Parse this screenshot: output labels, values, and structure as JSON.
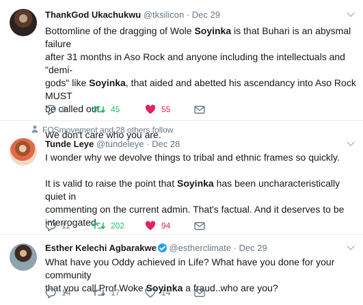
{
  "tweets": [
    {
      "name": "ThankGod Ukachukwu",
      "handle": "@tksilicon",
      "dot": "·",
      "date": "Dec 29",
      "line1a": "Bottomline of the dragging of Wole ",
      "highlight1": "Soyinka",
      "line1b": " is that Buhari is an abysmal failure",
      "line2": "after 31 months in Aso Rock and anyone including the intellectuals and \"demi-",
      "line3a": "gods\" like ",
      "highlight2": "Soyinka",
      "line3b": ", that aided and abetted his ascendancy into Aso Rock MUST",
      "line4": "be called out.",
      "line5": "We don't care who you are.",
      "reply_count": "8",
      "retweet_count": "45",
      "like_count": "55",
      "liked": true
    },
    {
      "social_context": "FOSmovement and 28 others follow",
      "name": "Tunde Leye",
      "handle": "@tundeleye",
      "dot": "·",
      "date": "Dec 28",
      "line1": "I wonder why we devolve things to tribal and ethnic frames so quickly.",
      "line2a": "It is valid to raise the point that ",
      "highlight1": "Soyinka",
      "line2b": " has been uncharacteristically quiet in",
      "line3": "commenting on the current admin. That's factual. And it deserves to be",
      "line4": "interrogated.",
      "reply_count": "11",
      "retweet_count": "202",
      "like_count": "94",
      "liked": true
    },
    {
      "name": "Esther Kelechi Agbarakwe",
      "handle": "@estherclimate",
      "dot": "·",
      "date": "Dec 29",
      "line1": "What have you Oddy achieved in Life? What have you done for your community",
      "line2a": "that you call Prof Woke ",
      "highlight1": "Soyinka",
      "line2b": "  a fraud..who are you?",
      "reply_count": "14",
      "retweet_count": "17",
      "like_count": "14",
      "liked": false
    }
  ],
  "colors": {
    "retweet": "#17bf63",
    "like": "#e0245e",
    "muted": "#657786",
    "verified": "#1da1f2"
  },
  "icons": [
    "reply-icon",
    "retweet-icon",
    "like-icon",
    "direct-message-icon",
    "verified-icon",
    "chevron-down-icon",
    "person-icon"
  ]
}
